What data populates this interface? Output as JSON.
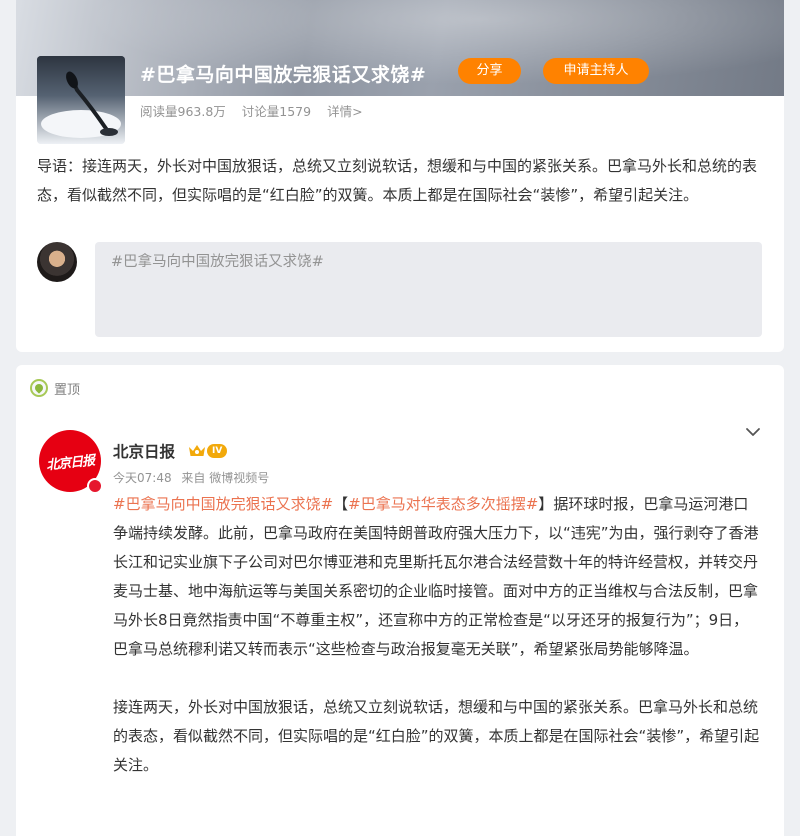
{
  "topic": {
    "title": "#巴拿马向中国放完狠话又求饶#",
    "share_label": "分享",
    "host_label": "申请主持人",
    "reads": "阅读量963.8万",
    "discussions": "讨论量1579",
    "details": "详情>",
    "intro": "导语：接连两天，外长对中国放狠话，总统又立刻说软话，想缓和与中国的紧张关系。巴拿马外长和总统的表态，看似截然不同，但实际唱的是“红白脸”的双簧。本质上都是在国际社会“装惨”，希望引起关注。",
    "composer_placeholder": "#巴拿马向中国放完狠话又求饶#"
  },
  "post": {
    "pin_label": "置顶",
    "author": "北京日报",
    "author_logo": "北京日报",
    "vip_level": "IV",
    "time": "今天07:48",
    "source": "来自 微博视频号",
    "tag1": "#巴拿马向中国放完狠话又求饶#",
    "bracket_open": "【",
    "tag2": "#巴拿马对华表态多次摇摆#",
    "bracket_close": "】",
    "para1_rest": "据环球时报，巴拿马运河港口争端持续发酵。此前，巴拿马政府在美国特朗普政府强大压力下，以“违宪”为由，强行剥夺了香港长江和记实业旗下子公司对巴尔博亚港和克里斯托瓦尔港合法经营数十年的特许经营权，并转交丹麦马士基、地中海航运等与美国关系密切的企业临时接管。面对中方的正当维权与合法反制，巴拿马外长8日竟然指责中国“不尊重主权”，还宣称中方的正常检查是“以牙还牙的报复行为”；9日，巴拿马总统穆利诺又转而表示“这些检查与政治报复毫无关联”，希望紧张局势能够降温。",
    "para2": "接连两天，外长对中国放狠话，总统又立刻说软话，想缓和与中国的紧张关系。巴拿马外长和总统的表态，看似截然不同，但实际唱的是“红白脸”的双簧，本质上都是在国际社会“装惨”，希望引起关注。"
  },
  "colors": {
    "accent_orange": "#ff8200",
    "tag_color": "#eb7350",
    "brand_red": "#e60012",
    "muted_text": "#939393"
  },
  "icons": [
    "pin-icon",
    "crown-icon",
    "chevron-down-icon",
    "verified-badge-icon",
    "microphone-image"
  ]
}
